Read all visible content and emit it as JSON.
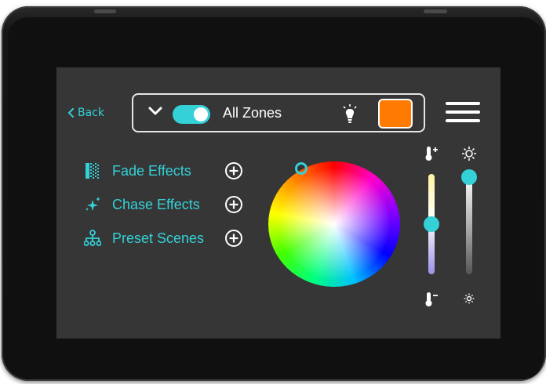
{
  "header": {
    "back_label": "Back",
    "zone_label": "All Zones",
    "power_on": true,
    "selected_color": "#ff7a00"
  },
  "effects": [
    {
      "label": "Fade Effects",
      "icon": "fade-icon"
    },
    {
      "label": "Chase Effects",
      "icon": "sparkle-icon"
    },
    {
      "label": "Preset Scenes",
      "icon": "hierarchy-icon"
    }
  ],
  "sliders": {
    "color_temperature": {
      "level": 0.5,
      "top_icon": "thermometer-plus-icon",
      "bottom_icon": "thermometer-minus-icon"
    },
    "brightness": {
      "level": 1.0,
      "top_icon": "sun-large-icon",
      "bottom_icon": "sun-small-icon"
    }
  },
  "colors": {
    "accent": "#34d1d8",
    "screen_bg": "#363636",
    "device_frame": "#121212"
  }
}
